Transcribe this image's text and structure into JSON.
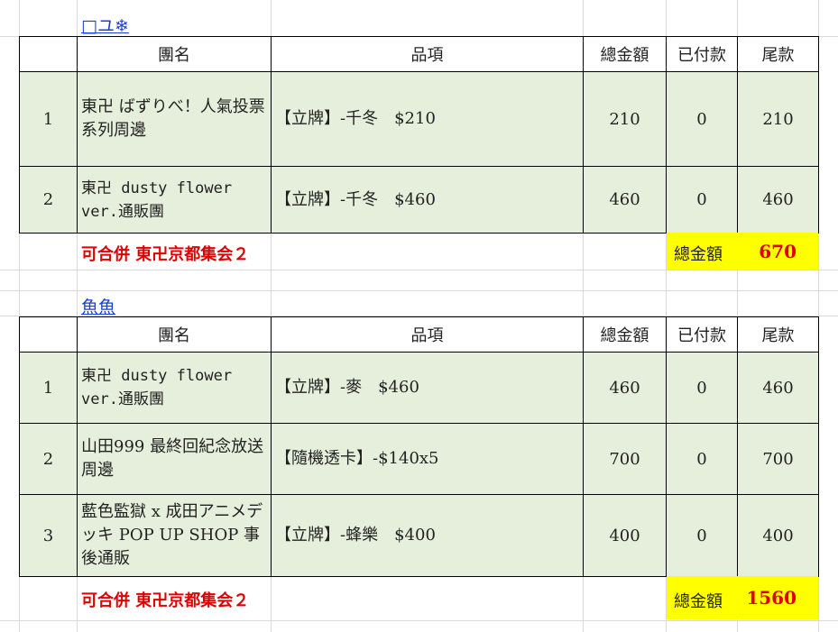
{
  "columns": [
    "團名",
    "品項",
    "總金額",
    "已付款",
    "尾款"
  ],
  "orders": [
    {
      "buyer": "□ユ❄",
      "rows": [
        {
          "no": "1",
          "group": "東卍 ばずりべ！人氣投票系列周邊",
          "item": "【立牌】-千冬　$210",
          "total": "210",
          "paid": "0",
          "balance": "210"
        },
        {
          "no": "2",
          "group": "東卍 dusty flower ver.通販團",
          "item": "【立牌】-千冬　$460",
          "total": "460",
          "paid": "0",
          "balance": "460"
        }
      ],
      "note": "可合併  東卍京都集会２",
      "total_label": "總金額",
      "total_value": "670"
    },
    {
      "buyer": "魚魚",
      "rows": [
        {
          "no": "1",
          "group": "東卍 dusty flower ver.通販團",
          "item": "【立牌】-麥　$460",
          "total": "460",
          "paid": "0",
          "balance": "460"
        },
        {
          "no": "2",
          "group": "山田999 最終回紀念放送周邊",
          "item": "【隨機透卡】-$140x5",
          "total": "700",
          "paid": "0",
          "balance": "700"
        },
        {
          "no": "3",
          "group": "藍色監獄 x 成田アニメデッキ POP UP SHOP 事後通販",
          "item": "【立牌】-蜂樂　$400",
          "total": "400",
          "paid": "0",
          "balance": "400"
        }
      ],
      "note": "可合併  東卍京都集会２",
      "total_label": "總金額",
      "total_value": "1560"
    }
  ]
}
